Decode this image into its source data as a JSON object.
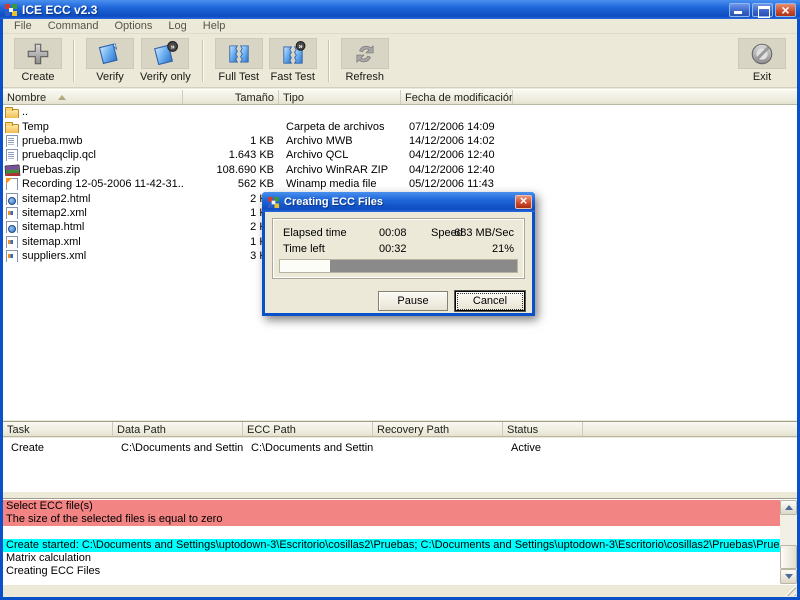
{
  "window": {
    "title": "ICE ECC v2.3"
  },
  "menu": {
    "items": [
      "File",
      "Command",
      "Options",
      "Log",
      "Help"
    ]
  },
  "toolbar": {
    "buttons": [
      {
        "label": "Create",
        "icon": "create-plus-icon"
      },
      {
        "label": "Verify",
        "icon": "verify-icon"
      },
      {
        "label": "Verify only",
        "icon": "verify-only-icon"
      },
      {
        "label": "Full Test",
        "icon": "full-test-icon"
      },
      {
        "label": "Fast Test",
        "icon": "fast-test-icon"
      },
      {
        "label": "Refresh",
        "icon": "refresh-icon"
      }
    ],
    "exit": {
      "label": "Exit",
      "icon": "exit-icon"
    }
  },
  "file_list": {
    "columns": [
      "Nombre",
      "Tamaño",
      "Tipo",
      "Fecha de modificación"
    ],
    "sort": {
      "column": "Nombre",
      "direction": "asc"
    },
    "rows": [
      {
        "icon": "folder",
        "name": "..",
        "size": "",
        "type": "",
        "date": ""
      },
      {
        "icon": "folder",
        "name": "Temp",
        "size": "",
        "type": "Carpeta de archivos",
        "date": "07/12/2006 14:09"
      },
      {
        "icon": "doc",
        "name": "prueba.mwb",
        "size": "1 KB",
        "type": "Archivo MWB",
        "date": "14/12/2006 14:02"
      },
      {
        "icon": "doc",
        "name": "pruebaqclip.qcl",
        "size": "1.643 KB",
        "type": "Archivo QCL",
        "date": "04/12/2006 12:40"
      },
      {
        "icon": "zip",
        "name": "Pruebas.zip",
        "size": "108.690 KB",
        "type": "Archivo WinRAR ZIP",
        "date": "04/12/2006 12:40"
      },
      {
        "icon": "media",
        "name": "Recording 12-05-2006 11-42-31...",
        "size": "562 KB",
        "type": "Winamp media file",
        "date": "05/12/2006 11:43"
      },
      {
        "icon": "html",
        "name": "sitemap2.html",
        "size": "2 KB",
        "type": "",
        "date": ""
      },
      {
        "icon": "xml",
        "name": "sitemap2.xml",
        "size": "1 KB",
        "type": "",
        "date": ""
      },
      {
        "icon": "html",
        "name": "sitemap.html",
        "size": "2 KB",
        "type": "",
        "date": ""
      },
      {
        "icon": "xml",
        "name": "sitemap.xml",
        "size": "1 KB",
        "type": "",
        "date": ""
      },
      {
        "icon": "xml",
        "name": "suppliers.xml",
        "size": "3 KB",
        "type": "",
        "date": ""
      }
    ]
  },
  "task_panel": {
    "columns": [
      "Task",
      "Data Path",
      "ECC Path",
      "Recovery Path",
      "Status"
    ],
    "rows": [
      {
        "task": "Create",
        "data_path": "C:\\Documents and Settings...",
        "ecc_path": "C:\\Documents and Settings...",
        "recovery_path": "",
        "status": "Active"
      }
    ]
  },
  "log": {
    "lines": [
      {
        "text": "Select ECC file(s)",
        "highlight": "error"
      },
      {
        "text": "The size of the selected files is equal to zero",
        "highlight": "error"
      },
      {
        "text": "",
        "highlight": "none"
      },
      {
        "text": "Create started: C:\\Documents and Settings\\uptodown-3\\Escritorio\\cosillas2\\Pruebas; C:\\Documents and Settings\\uptodown-3\\Escritorio\\cosillas2\\Pruebas\\Pruebas.ecc",
        "highlight": "info"
      },
      {
        "text": "Matrix calculation",
        "highlight": "none"
      },
      {
        "text": "Creating ECC Files",
        "highlight": "none"
      }
    ]
  },
  "dialog": {
    "title": "Creating ECC Files",
    "elapsed_label": "Elapsed time",
    "elapsed_value": "00:08",
    "speed_label": "Speed",
    "speed_value": "683 MB/Sec",
    "timeleft_label": "Time left",
    "timeleft_value": "00:32",
    "percent": "21%",
    "progress_percent": 21,
    "pause_label": "Pause",
    "cancel_label": "Cancel"
  },
  "colors": {
    "error_bg": "#f28484",
    "info_bg": "#00ffff",
    "titlebar_blue": "#1f66da",
    "chrome_bg": "#ece9d8"
  }
}
